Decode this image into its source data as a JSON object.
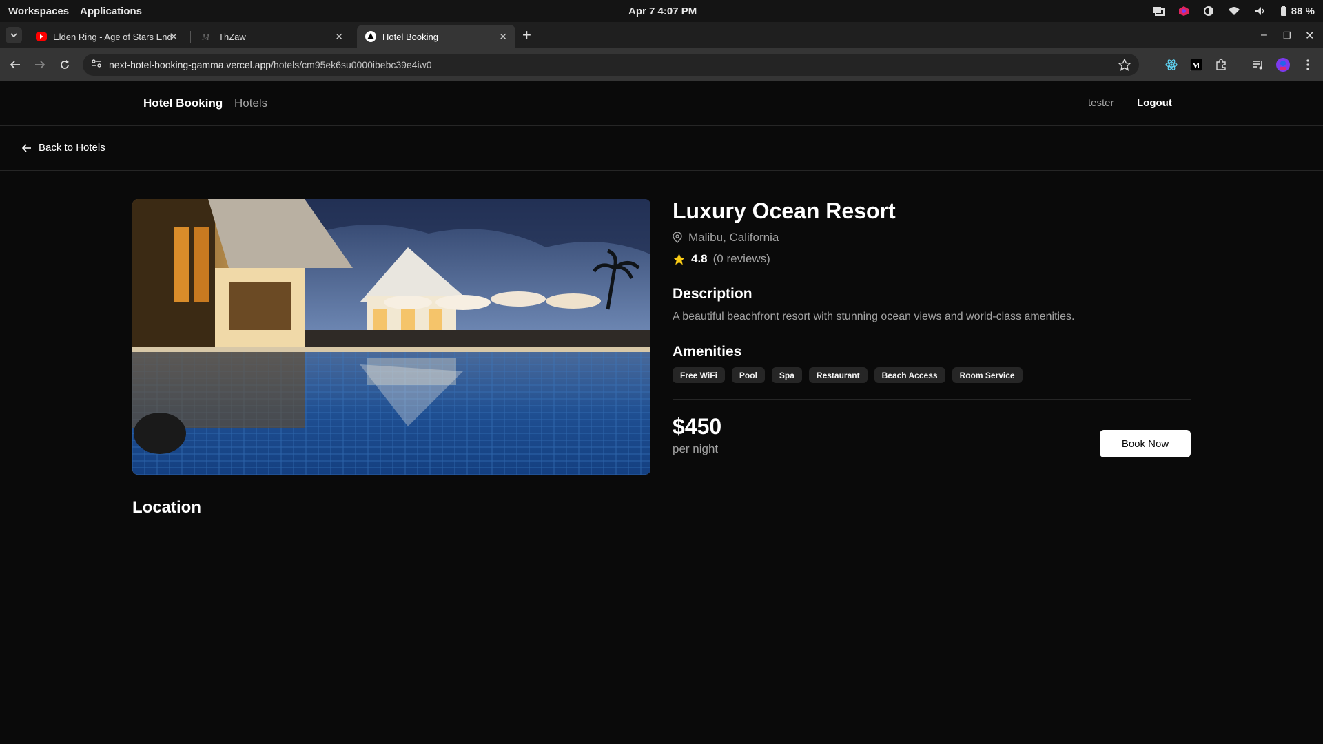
{
  "os": {
    "workspaces": "Workspaces",
    "applications": "Applications",
    "datetime": "Apr 7  4:07 PM",
    "battery": "88 %"
  },
  "browser": {
    "tabs": [
      {
        "title": "Elden Ring - Age of Stars Endgame",
        "icon": "youtube-icon"
      },
      {
        "title": "ThZaw",
        "icon": "thzaw-icon"
      },
      {
        "title": "Hotel Booking",
        "icon": "vercel-icon",
        "active": true
      }
    ],
    "url_host": "next-hotel-booking-gamma.vercel.app",
    "url_path": "/hotels/cm95ek6su0000ibebc39e4iw0"
  },
  "header": {
    "brand": "Hotel Booking",
    "nav_hotels": "Hotels",
    "username": "tester",
    "logout": "Logout"
  },
  "back": {
    "label": "Back to Hotels"
  },
  "hotel": {
    "name": "Luxury Ocean Resort",
    "location": "Malibu, California",
    "rating": "4.8",
    "reviews": "(0 reviews)",
    "description_heading": "Description",
    "description": "A beautiful beachfront resort with stunning ocean views and world-class amenities.",
    "amenities_heading": "Amenities",
    "amenities": [
      "Free WiFi",
      "Pool",
      "Spa",
      "Restaurant",
      "Beach Access",
      "Room Service"
    ],
    "price": "$450",
    "price_unit": "per night",
    "book_label": "Book Now",
    "location_heading": "Location"
  },
  "colors": {
    "background": "#0a0a0a",
    "muted_text": "#a3a3a3",
    "star": "#facc15",
    "chip_bg": "#262626"
  }
}
